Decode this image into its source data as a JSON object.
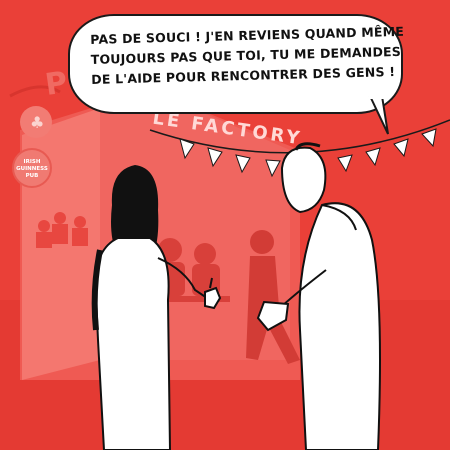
{
  "speech_bubble": {
    "lines": [
      "PAS DE SOUCI ! J'EN REVIENS QUAND MÊME",
      "TOUJOURS PAS QUE TOI, TU ME DEMANDES",
      "DE L'AIDE POUR RENCONTRER DES GENS !"
    ]
  },
  "background_signs": {
    "pub_letters": "PUB",
    "factory": "LE FACTORY",
    "irish_sign": [
      "IRISH",
      "GUINNESS",
      "PUB"
    ]
  },
  "colors": {
    "background": "#ea4038",
    "background_light": "#f07a72",
    "figure_fill": "#ffffff",
    "ink": "#111111"
  }
}
